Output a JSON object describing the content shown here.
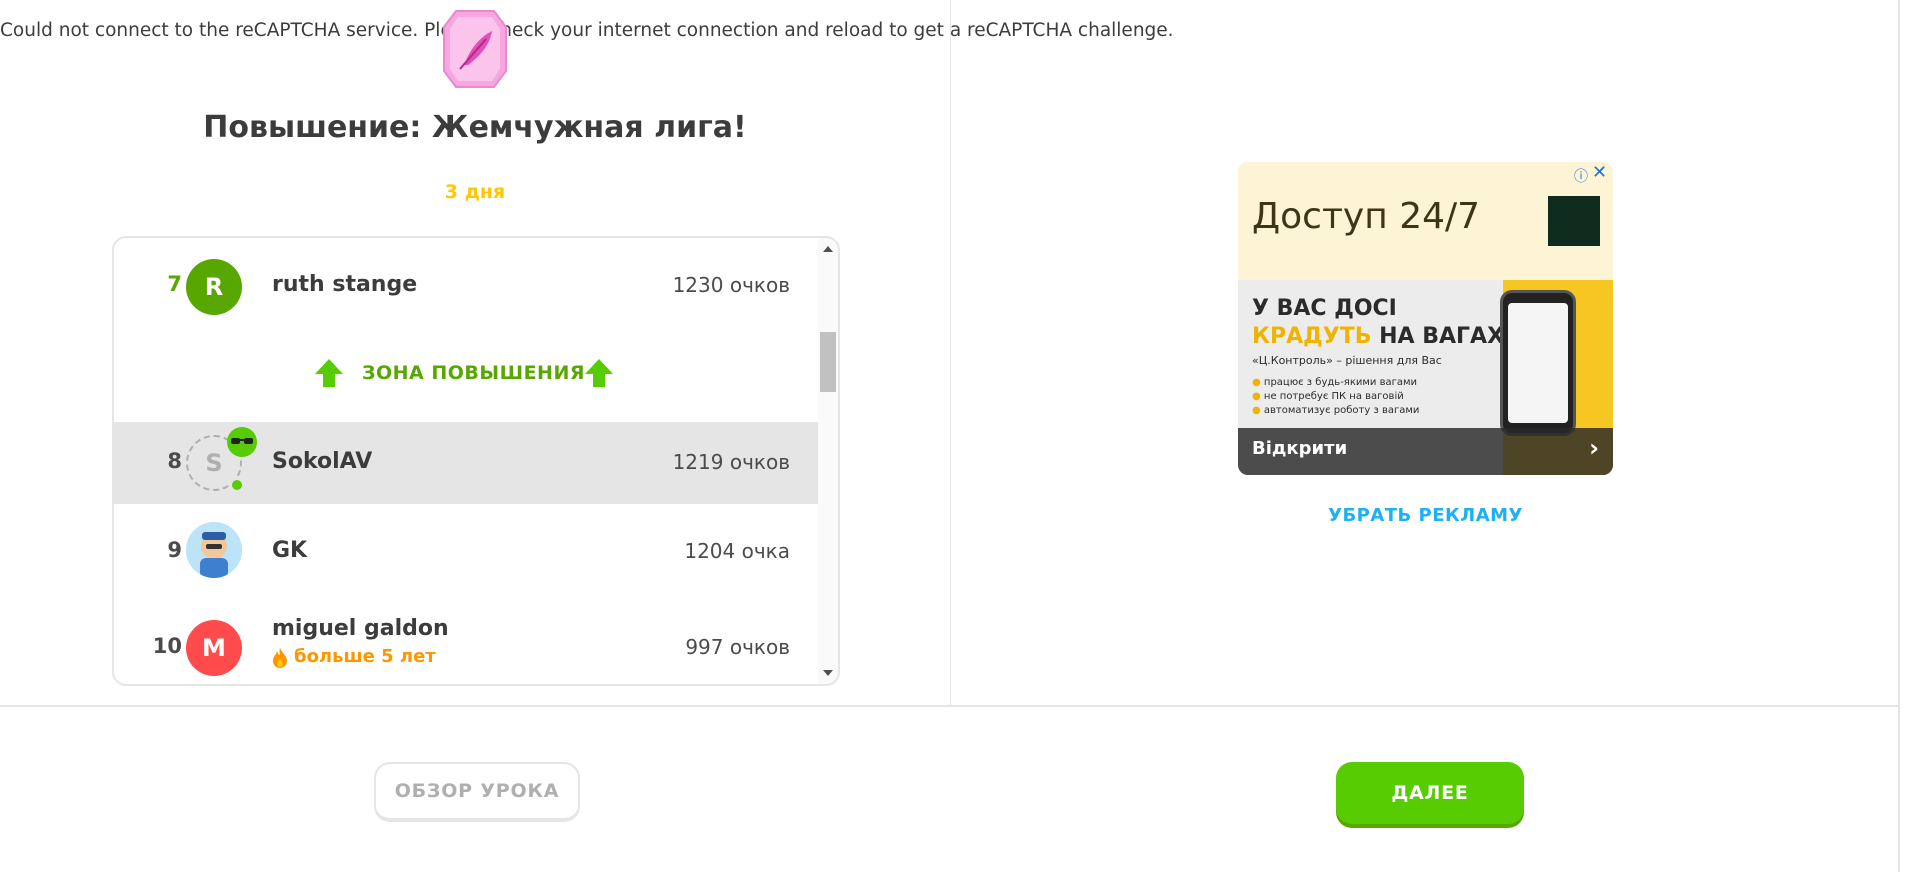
{
  "captcha_message": "Could not connect to the reCAPTCHA service. Please check your internet connection and reload to get a reCAPTCHA challenge.",
  "league": {
    "title": "Повышение: Жемчужная лига!",
    "time_left": "3 дня",
    "promotion_zone_label": "ЗОНА ПОВЫШЕНИЯ"
  },
  "leaderboard": {
    "rows": [
      {
        "rank": "7",
        "initial": "R",
        "name": "ruth stange",
        "points": "1230 очков",
        "avatar_color": "#58a700"
      },
      {
        "rank": "8",
        "initial": "S",
        "name": "SokolAV",
        "points": "1219 очков"
      },
      {
        "rank": "9",
        "initial": "",
        "name": "GK",
        "points": "1204 очка"
      },
      {
        "rank": "10",
        "initial": "M",
        "name": "miguel galdon",
        "points": "997 очков",
        "streak": "больше 5 лет",
        "avatar_color": "#ff4b4b"
      }
    ]
  },
  "ad": {
    "headline": "Доступ 24/7",
    "line1": "У ВАС ДОСІ",
    "line2_highlight": "КРАДУТЬ",
    "line2_rest": " НА ВАГАХ?",
    "line3": "«Ц.Контроль» – рішення для Вас",
    "bullets": [
      "працює з будь-якими вагами",
      "не потребує ПК на ваговій",
      "автоматизує роботу з вагами"
    ],
    "cta": "Відкрити",
    "info_icon": "ⓘ",
    "close_icon": "✕",
    "arrow_icon": "›"
  },
  "remove_ads_label": "УБРАТЬ РЕКЛАМУ",
  "buttons": {
    "review": "ОБЗОР УРОКА",
    "next": "ДАЛЕЕ"
  },
  "colors": {
    "accent_green": "#58cc02",
    "promotion_green": "#58a700",
    "time_yellow": "#ffc800",
    "link_blue": "#1cb0f6",
    "streak_orange": "#ff9600"
  }
}
